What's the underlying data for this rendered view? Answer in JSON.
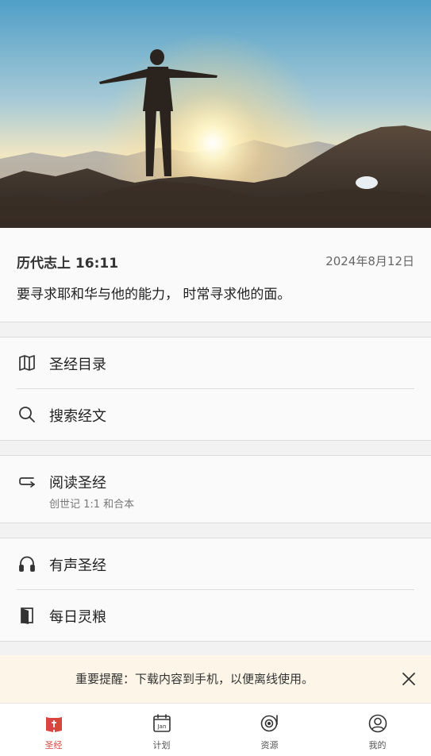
{
  "verse": {
    "reference": "历代志上 16:11",
    "date": "2024年8月12日",
    "text": "要寻求耶和华与他的能力， 时常寻求他的面。"
  },
  "menu": {
    "group1": [
      {
        "label": "圣经目录",
        "icon": "book-open-icon"
      },
      {
        "label": "搜索经文",
        "icon": "search-icon"
      }
    ],
    "group2": [
      {
        "label": "阅读圣经",
        "sub": "创世记 1:1 和合本",
        "icon": "return-arrow-icon"
      }
    ],
    "group3": [
      {
        "label": "有声圣经",
        "icon": "headphones-icon"
      },
      {
        "label": "每日灵粮",
        "icon": "door-icon"
      }
    ]
  },
  "notice": {
    "text": "重要提醒：下载内容到手机，以便离线使用。"
  },
  "tabs": [
    {
      "label": "圣经",
      "icon": "bible-icon",
      "active": true
    },
    {
      "label": "计划",
      "icon": "calendar-icon",
      "icon_text": "Jan"
    },
    {
      "label": "资源",
      "icon": "record-icon"
    },
    {
      "label": "我的",
      "icon": "profile-icon"
    }
  ],
  "colors": {
    "accent": "#d9453f",
    "notice_bg": "#fdf6e8"
  }
}
